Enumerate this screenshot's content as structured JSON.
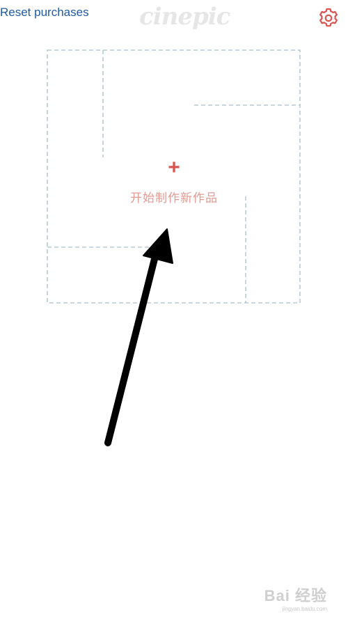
{
  "header": {
    "reset_label": "Reset purchases",
    "logo_text": "cinepic",
    "settings_icon": "gear-icon"
  },
  "canvas": {
    "create_label": "开始制作新作品",
    "plus_symbol": "+",
    "add_icon": "plus-icon"
  },
  "watermark": {
    "text": "Bai 经验",
    "url": "jingyan.baidu.com"
  },
  "colors": {
    "link": "#1f5aa6",
    "accent": "#d9534f",
    "label": "#e39a93",
    "dashed_border": "#a9bfc9",
    "logo": "#e6e6e6"
  }
}
